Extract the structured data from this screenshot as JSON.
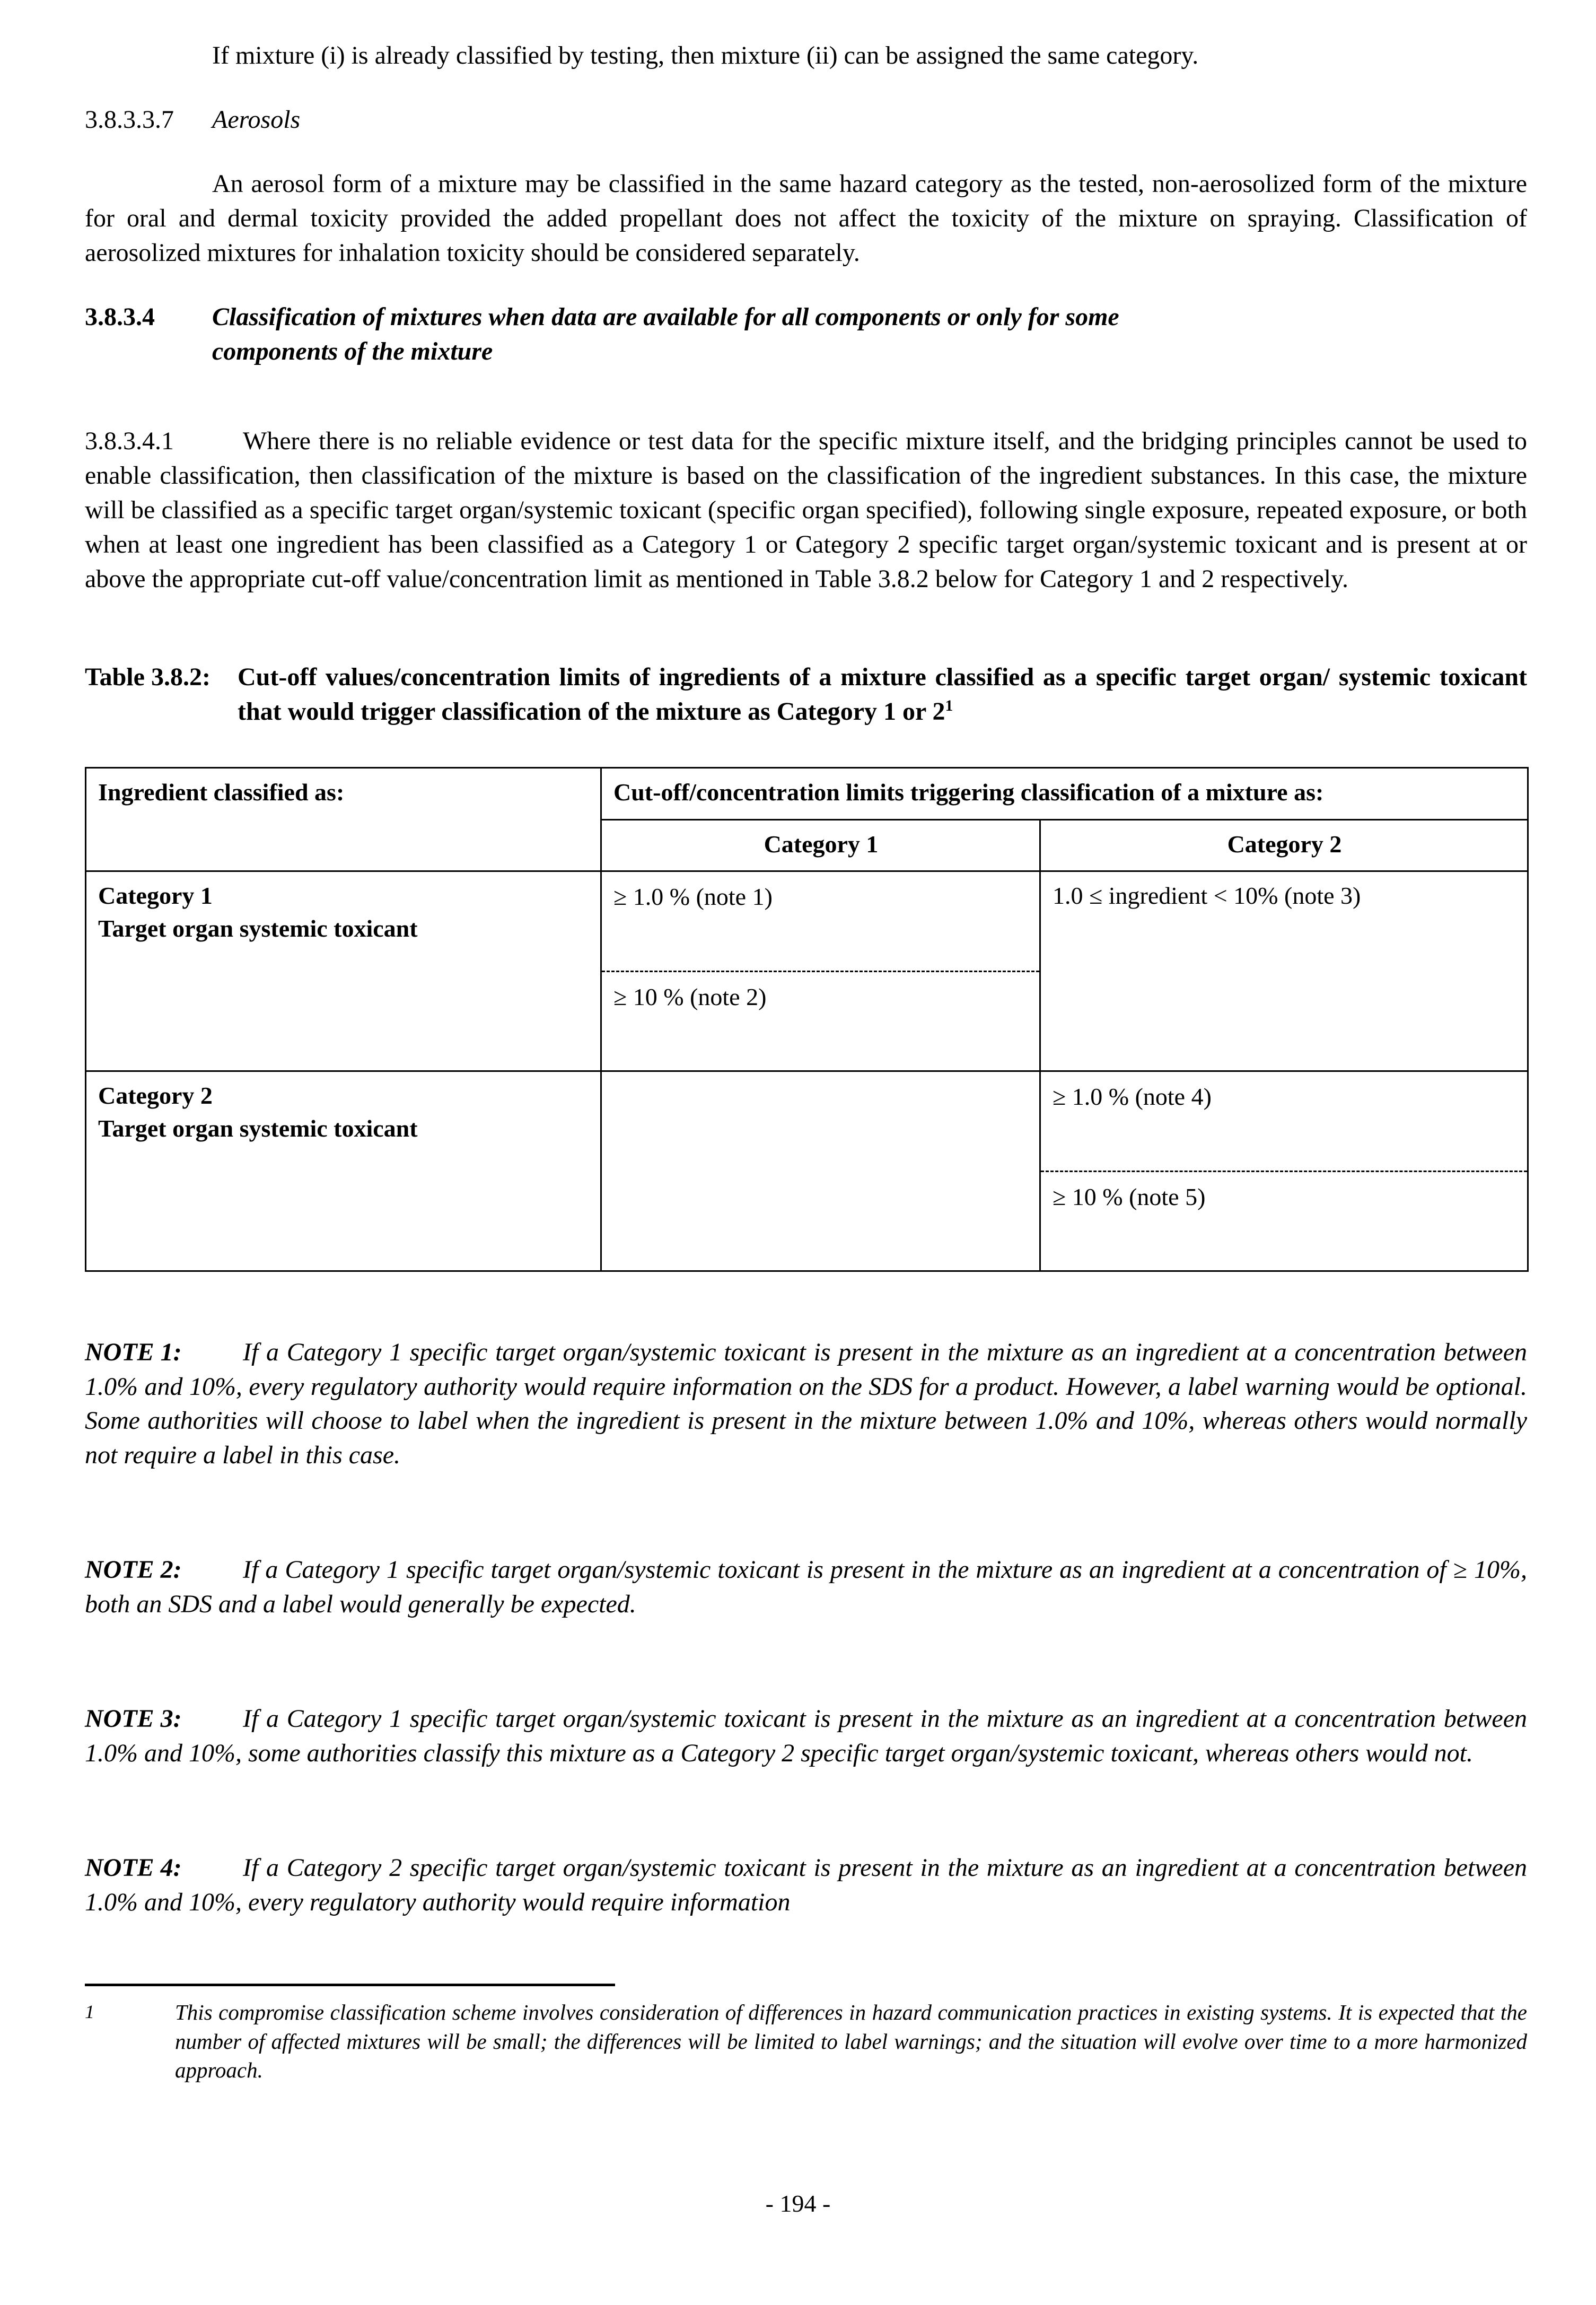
{
  "document": {
    "page_number": "- 194 -"
  },
  "intro": {
    "paragraph": "If mixture (i) is already classified by testing, then mixture (ii) can be assigned the same category."
  },
  "sections": [
    {
      "number": "3.8.3.3.7",
      "title": "Aerosols",
      "body": "An aerosol form of a mixture may be classified in the same hazard category as the tested, non-aerosolized form of the mixture for oral and dermal toxicity provided the added propellant does not affect the toxicity of the mixture on spraying. Classification of aerosolized mixtures for inhalation toxicity should be considered separately."
    },
    {
      "number": "3.8.3.4",
      "title_line1": "Classification of mixtures when data are available for all components or only for some",
      "title_line2": "components of the mixture"
    }
  ],
  "clause": {
    "number": "3.8.3.4.1",
    "text": "Where there is no reliable evidence or test data for the specific mixture itself, and the bridging principles cannot be used to enable classification, then classification of the mixture is based on the classification of the ingredient substances. In this case, the mixture will be classified as a specific target organ/systemic toxicant (specific organ specified), following single exposure, repeated exposure, or both when at least one ingredient has been classified as a Category 1 or Category 2 specific target organ/systemic toxicant and is present at or above the appropriate cut-off value/concentration limit as mentioned in Table 3.8.2 below for Category 1 and 2 respectively."
  },
  "table_caption": {
    "label": "Table 3.8.2:",
    "text": "Cut-off values/concentration limits of ingredients of a mixture classified as a specific target organ/ systemic toxicant that would trigger classification of the mixture as Category 1 or 2",
    "footnote_marker": "1"
  },
  "table": {
    "header": {
      "col1": "Ingredient classified as:",
      "col2_span": "Cut-off/concentration limits triggering classification of a mixture as:",
      "col2_sub1": "Category 1",
      "col2_sub2": "Category 2"
    },
    "rows": [
      {
        "ingredient_line1": "Category 1",
        "ingredient_line2": "Target organ systemic toxicant",
        "cat1_top": "≥ 1.0 % (note 1)",
        "cat1_bottom": "≥ 10 % (note 2)",
        "cat2": "1.0 ≤ ingredient < 10% (note 3)"
      },
      {
        "ingredient_line1": "Category 2",
        "ingredient_line2": "Target organ systemic toxicant",
        "cat1": "",
        "cat2_top": "≥ 1.0 % (note 4)",
        "cat2_bottom": "≥ 10 % (note 5)"
      }
    ]
  },
  "notes": [
    {
      "label": "NOTE 1:",
      "text": "If a Category 1 specific target organ/systemic toxicant is present in the mixture as an ingredient at a concentration between 1.0% and 10%, every regulatory authority would require information on the SDS for a product. However, a label warning would be optional. Some authorities will choose to label when the ingredient is present in the mixture between 1.0% and 10%, whereas others would normally not require a label in this case."
    },
    {
      "label": "NOTE 2:",
      "text": "If a Category 1 specific target organ/systemic toxicant is present in the mixture as an ingredient at a concentration of ≥ 10%, both an SDS and a label would generally be expected."
    },
    {
      "label": "NOTE 3:",
      "text": "If a Category 1 specific target organ/systemic toxicant is present in the mixture as an ingredient at a concentration between 1.0% and 10%, some authorities classify this mixture as a Category 2 specific target organ/systemic toxicant, whereas others would not."
    },
    {
      "label": "NOTE 4:",
      "text": "If a Category 2 specific target organ/systemic toxicant is present in the mixture as an ingredient at a concentration between 1.0% and 10%, every regulatory authority would require information"
    }
  ],
  "footnote": {
    "marker": "1",
    "text": "This compromise classification scheme involves consideration of differences in hazard communication practices in existing systems. It is expected that the number of affected mixtures will be small; the differences will be limited to label warnings; and the situation will evolve over time to a more harmonized approach."
  }
}
